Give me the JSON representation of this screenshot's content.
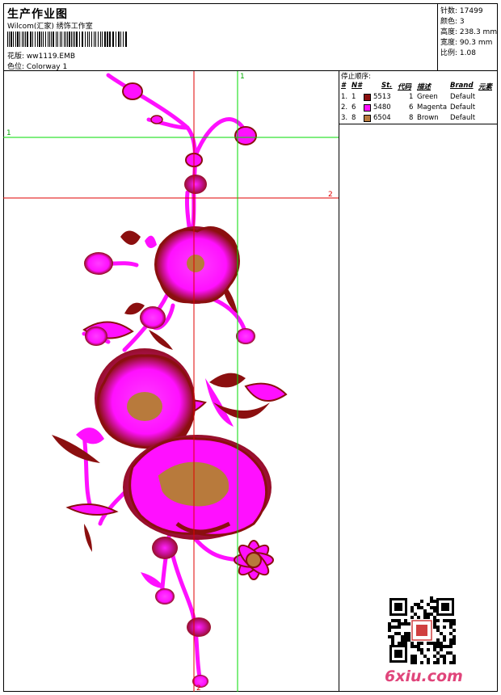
{
  "header": {
    "title": "生产作业图",
    "subtitle": "Wilcom(汇家) 绣饰工作室",
    "design_label": "花版:",
    "design_value": "ww1119.EMB",
    "colorway_label": "色位:",
    "colorway_value": "Colorway 1"
  },
  "stats": {
    "stitches_label": "针数:",
    "stitches_value": "17499",
    "colors_label": "颜色:",
    "colors_value": "3",
    "height_label": "高度:",
    "height_value": "238.3 mm",
    "width_label": "宽度:",
    "width_value": "90.3 mm",
    "scale_label": "比例:",
    "scale_value": "1.08"
  },
  "stop_sequence": {
    "heading": "停止顺序:",
    "columns": [
      "#",
      "N#",
      "St.",
      "代码",
      "描述",
      "Brand",
      "元素"
    ],
    "rows": [
      {
        "index": "1.",
        "needle": "1",
        "code": "5513",
        "stop": "1",
        "desc": "Green",
        "brand": "Default",
        "color": "#8b0f0f"
      },
      {
        "index": "2.",
        "needle": "6",
        "code": "5480",
        "stop": "6",
        "desc": "Magenta",
        "brand": "Default",
        "color": "#ff10ff"
      },
      {
        "index": "3.",
        "needle": "8",
        "code": "6504",
        "stop": "8",
        "desc": "Brown",
        "brand": "Default",
        "color": "#b87a3c"
      }
    ]
  },
  "guides": {
    "h1_label": "1",
    "h2_label": "2",
    "v1_label": "1",
    "v2_label": "2",
    "green": "#00dd00",
    "red": "#e00000"
  },
  "watermark": {
    "text": "6xiu.com"
  }
}
